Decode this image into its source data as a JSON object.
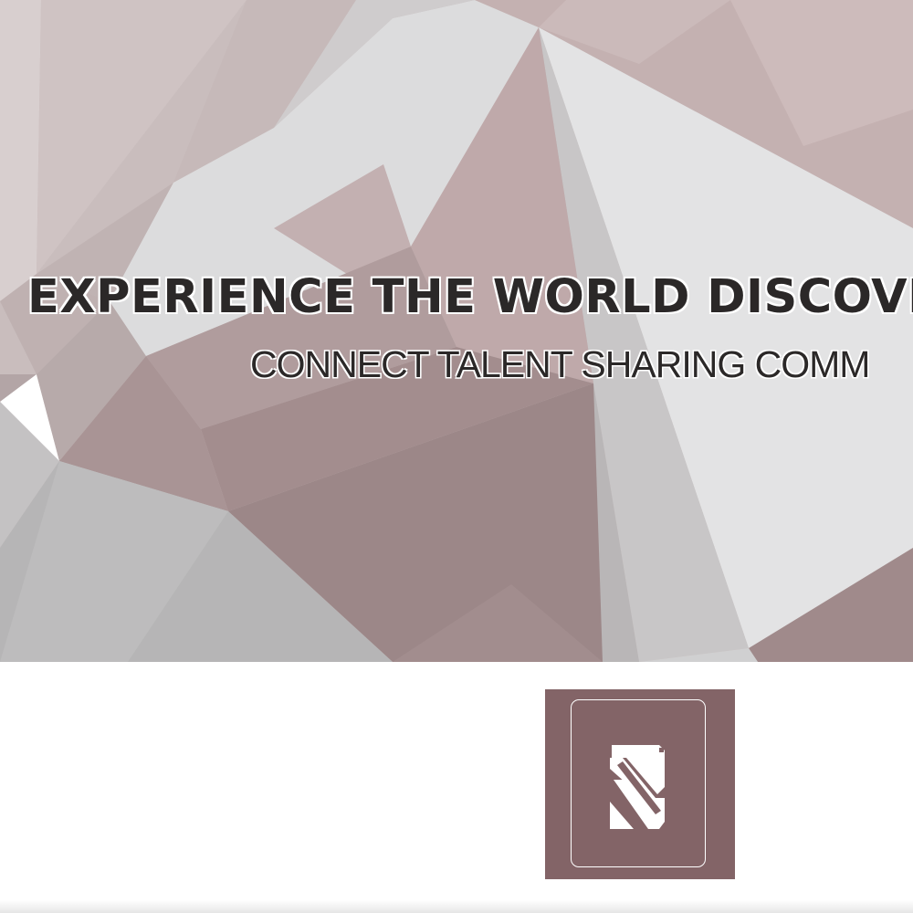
{
  "banner": {
    "headline": "EXPERIENCE THE WORLD DISCOVE",
    "tagline": "CONNECT TALENT SHARING COMM"
  },
  "logo": {
    "icon": "stylized-s-monogram-icon",
    "background_color": "#836467",
    "mark_color": "#ffffff"
  },
  "colors": {
    "mauve": "#b9a5a6",
    "light_gray": "#e0e0e1",
    "mid_gray": "#b4b4b6",
    "text_dark": "#2b2828"
  }
}
